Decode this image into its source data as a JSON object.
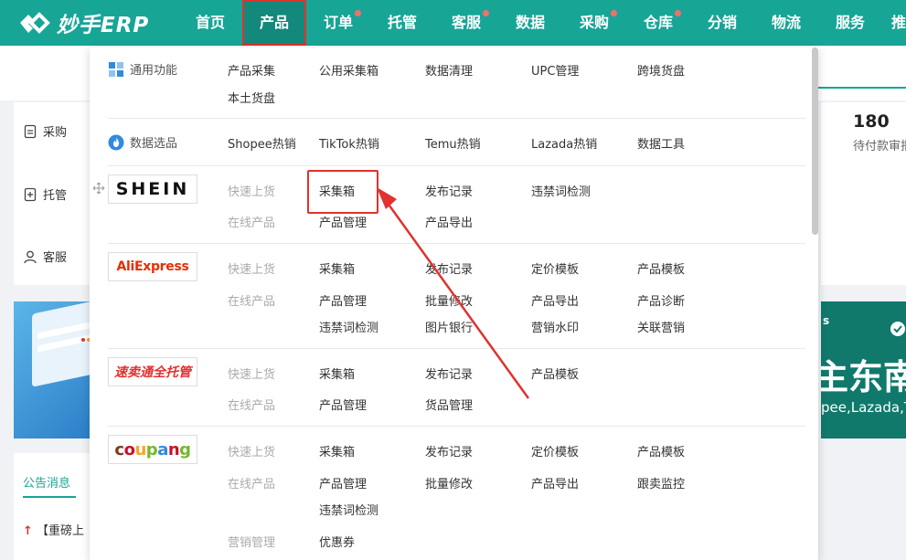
{
  "app": {
    "name": "妙手ERP"
  },
  "nav": {
    "items": [
      {
        "label": "首页",
        "dot": false,
        "active": false
      },
      {
        "label": "产品",
        "dot": false,
        "active": true
      },
      {
        "label": "订单",
        "dot": true,
        "active": false
      },
      {
        "label": "托管",
        "dot": false,
        "active": false
      },
      {
        "label": "客服",
        "dot": true,
        "active": false
      },
      {
        "label": "数据",
        "dot": false,
        "active": false
      },
      {
        "label": "采购",
        "dot": true,
        "active": false
      },
      {
        "label": "仓库",
        "dot": true,
        "active": false
      },
      {
        "label": "分销",
        "dot": false,
        "active": false
      },
      {
        "label": "物流",
        "dot": false,
        "active": false
      },
      {
        "label": "服务",
        "dot": false,
        "active": false
      },
      {
        "label": "推",
        "dot": false,
        "active": false
      }
    ]
  },
  "sidebar": {
    "items": [
      {
        "label": "采购",
        "icon": "document-icon"
      },
      {
        "label": "托管",
        "icon": "upload-doc-icon"
      },
      {
        "label": "客服",
        "icon": "user-icon"
      }
    ]
  },
  "stats": {
    "value": "180",
    "label": "待付款审批"
  },
  "banner": {
    "big_text": "主东南",
    "small_text": "pee,Lazada,T",
    "corner_text": "s"
  },
  "notices": {
    "tab": "公告消息",
    "item_prefix": "↑",
    "item_text": "【重磅上"
  },
  "dropdown": {
    "general": {
      "label": "通用功能",
      "links": [
        "产品采集",
        "公用采集箱",
        "数据清理",
        "UPC管理",
        "跨境货盘",
        "本土货盘"
      ]
    },
    "data_select": {
      "label": "数据选品",
      "links": [
        "Shopee热销",
        "TikTok热销",
        "Temu热销",
        "Lazada热销",
        "数据工具"
      ]
    },
    "platforms": [
      {
        "brand": "SHEIN",
        "row1_label": "快速上货",
        "row1": [
          "采集箱",
          "发布记录",
          "违禁词检测"
        ],
        "row2_label": "在线产品",
        "row2": [
          "产品管理",
          "产品导出"
        ]
      },
      {
        "brand": "AliExpress",
        "row1_label": "快速上货",
        "row1": [
          "采集箱",
          "发布记录",
          "定价模板",
          "产品模板"
        ],
        "row2_label": "在线产品",
        "row2": [
          "产品管理",
          "批量修改",
          "产品导出",
          "产品诊断"
        ],
        "row3": [
          "违禁词检测",
          "图片银行",
          "营销水印",
          "关联营销"
        ]
      },
      {
        "brand": "速卖通全托管",
        "row1_label": "快速上货",
        "row1": [
          "采集箱",
          "发布记录",
          "产品模板"
        ],
        "row2_label": "在线产品",
        "row2": [
          "产品管理",
          "货品管理"
        ]
      },
      {
        "brand": "coupang",
        "row1_label": "快速上货",
        "row1": [
          "采集箱",
          "发布记录",
          "定价模板",
          "产品模板"
        ],
        "row2_label": "在线产品",
        "row2": [
          "产品管理",
          "批量修改",
          "产品导出",
          "跟卖监控"
        ],
        "row3": [
          "违禁词检测"
        ],
        "row4_label": "营销管理",
        "row4": [
          "优惠券"
        ]
      }
    ]
  },
  "colors": {
    "brand": "#17a596",
    "highlight": "#e0322e",
    "ali": "#e62e04",
    "coupang_red": "#c8102e"
  }
}
